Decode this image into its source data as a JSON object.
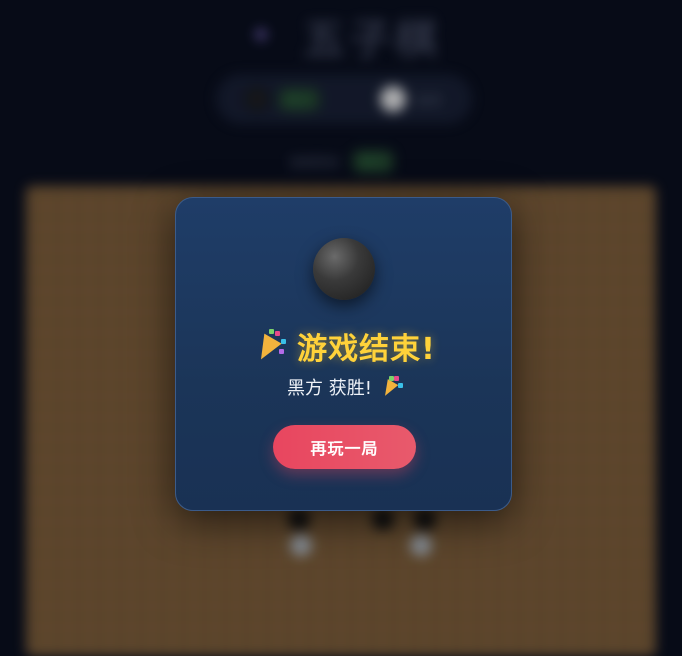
{
  "game": {
    "title": "五子棋",
    "title_icon": "puzzle-icon",
    "players": [
      {
        "stone": "black",
        "label": "黑方",
        "active": true
      },
      {
        "stone": "white",
        "label": "白方",
        "active": false
      }
    ],
    "turn_label": "当前回合",
    "turn_value": "黑方"
  },
  "modal": {
    "winner_stone": "black",
    "title": "游戏结束!",
    "title_icon": "party-popper-icon",
    "result_text": "黑方 获胜!",
    "result_icon": "party-popper-icon",
    "restart_label": "再玩一局"
  },
  "colors": {
    "modal_bg": "#1f3d68",
    "title_color": "#ffd23a",
    "button_color": "#e8465f",
    "page_bg": "#070b17"
  }
}
